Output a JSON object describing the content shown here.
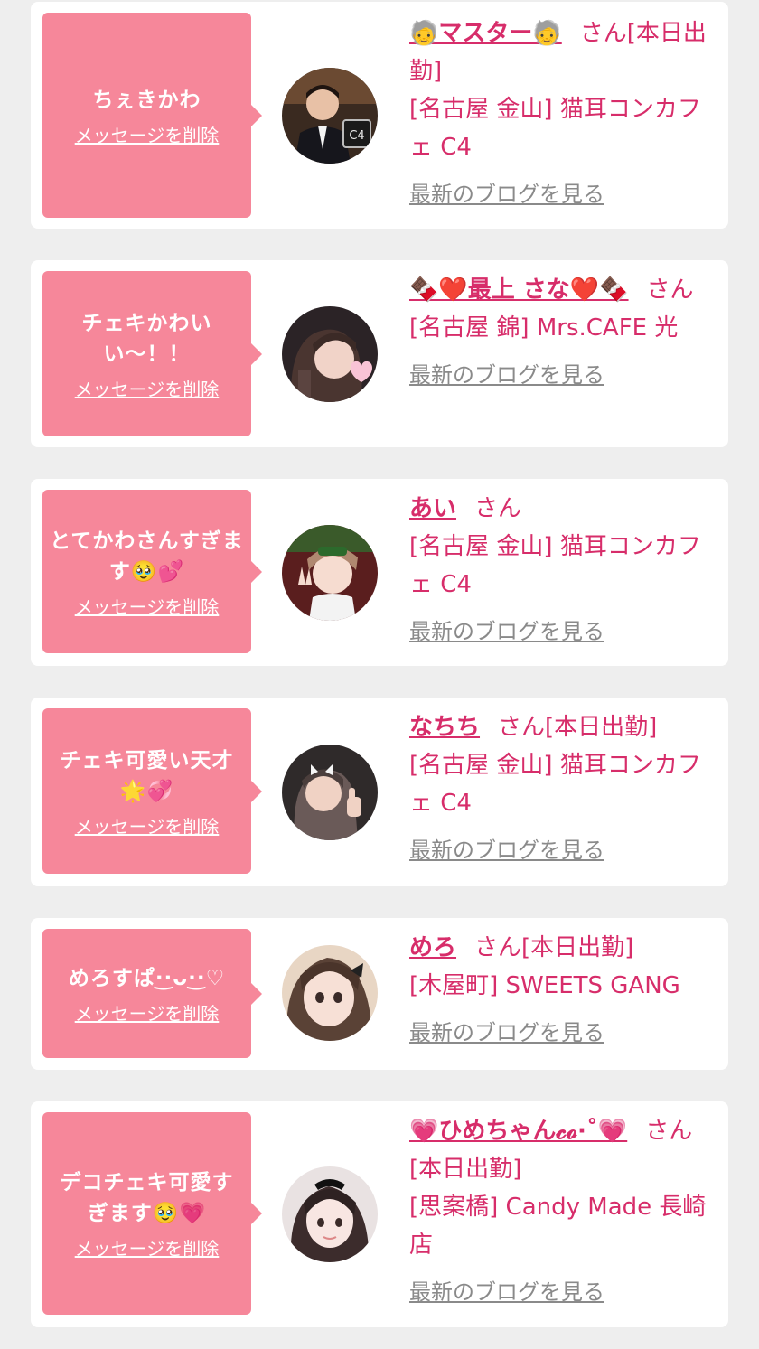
{
  "delete_label": "メッセージを削除",
  "blog_label": "最新のブログを見る",
  "honorific": "さん",
  "colors": {
    "background": "#eeeeee",
    "card": "#ffffff",
    "bubble": "#f6879a",
    "accent_text": "#d72d6a",
    "muted_link": "#8a8a8a"
  },
  "messages": [
    {
      "message": "ちぇきかわ",
      "cast_name": "🧓マスター🧓",
      "status": "[本日出勤]",
      "shop": "[名古屋 金山] 猫耳コンカフェ C4",
      "avatar_icon": "avatar-photo-man-suit"
    },
    {
      "message": "チェキかわいい〜！！",
      "cast_name": "🍫❤️最上 さな❤️🍫",
      "status": "",
      "shop": "[名古屋 錦] Mrs.CAFE 光",
      "avatar_icon": "avatar-photo-girl-heart"
    },
    {
      "message": "とてかわさんすぎます🥹💕",
      "cast_name": "あい",
      "status": "",
      "shop": "[名古屋 金山] 猫耳コンカフェ C4",
      "avatar_icon": "avatar-photo-girl-peace"
    },
    {
      "message": "チェキ可愛い天才🌟💞",
      "cast_name": "なちち",
      "status": "[本日出勤]",
      "shop": "[名古屋 金山] 猫耳コンカフェ C4",
      "avatar_icon": "avatar-photo-girl-thumbsup"
    },
    {
      "message": "めろすぱ·͜·ᴗ·͜·♡",
      "cast_name": "めろ",
      "status": "[本日出勤]",
      "shop": "[木屋町] SWEETS GANG",
      "avatar_icon": "avatar-photo-girl-closeup"
    },
    {
      "message": "デコチェキ可愛すぎます🥹💗",
      "cast_name": "💗ひめちゃん𝓬𝓸·˚💗",
      "status": "[本日出勤]",
      "shop": "[思案橋] Candy Made 長崎店",
      "avatar_icon": "avatar-photo-girl-bow"
    }
  ]
}
